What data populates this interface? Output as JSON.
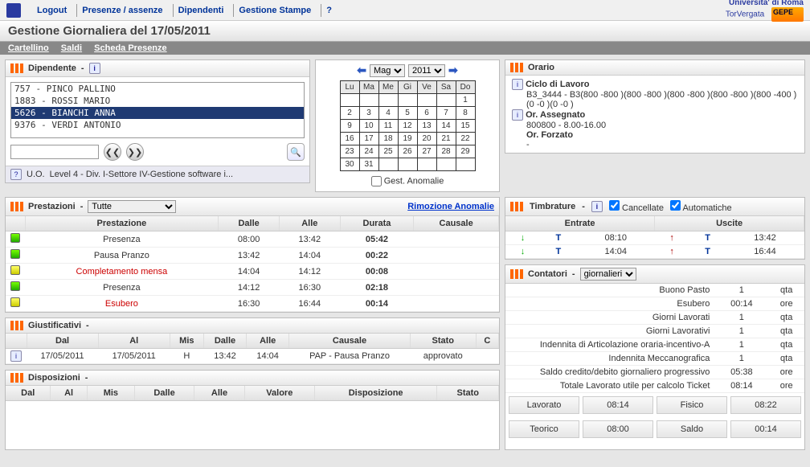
{
  "nav": {
    "logout": "Logout",
    "presenze": "Presenze / assenze",
    "dipendenti": "Dipendenti",
    "stampe": "Gestione Stampe",
    "help": "?"
  },
  "brand": {
    "line1": "Universita' di Roma",
    "line2": "TorVergata"
  },
  "title": "Gestione Giornaliera del 17/05/2011",
  "subtabs": {
    "cartellino": "Cartellino",
    "saldi": "Saldi",
    "scheda": "Scheda Presenze"
  },
  "dipendente": {
    "head": "Dipendente",
    "dash": "-",
    "list": [
      {
        "text": "757 - PINCO PALLINO"
      },
      {
        "text": "1883 - ROSSI MARIO"
      },
      {
        "text": "5626 - BIANCHI ANNA",
        "selected": true
      },
      {
        "text": "9376 - VERDI ANTONIO"
      }
    ],
    "uo_label": "U.O.",
    "uo_text": "Level 4 - Div. I-Settore IV-Gestione software i..."
  },
  "calendar": {
    "month": "Mag",
    "year": "2011",
    "dow": [
      "Lu",
      "Ma",
      "Me",
      "Gi",
      "Ve",
      "Sa",
      "Do"
    ],
    "weeks": [
      [
        "",
        "",
        "",
        "",
        "",
        "",
        "1"
      ],
      [
        "2",
        "3",
        "4",
        "5",
        "6",
        "7",
        "8"
      ],
      [
        "9",
        "10",
        "11",
        "12",
        "13",
        "14",
        "15"
      ],
      [
        "16",
        "17",
        "18",
        "19",
        "20",
        "21",
        "22"
      ],
      [
        "23",
        "24",
        "25",
        "26",
        "27",
        "28",
        "29"
      ],
      [
        "30",
        "31",
        "",
        "",
        "",
        "",
        ""
      ]
    ],
    "gest": "Gest. Anomalie"
  },
  "orario": {
    "head": "Orario",
    "ciclo_lbl": "Ciclo di Lavoro",
    "ciclo_val": "B3_3444 - B3(800 -800 )(800 -800 )(800 -800 )(800 -800 )(800 -400 )(0 -0 )(0 -0 )",
    "ass_lbl": "Or. Assegnato",
    "ass_val": "800800 - 8.00-16.00",
    "forz_lbl": "Or. Forzato",
    "forz_val": "-"
  },
  "prest": {
    "head": "Prestazioni",
    "dash": "-",
    "filter": "Tutte",
    "link": "Rimozione Anomalie",
    "cols": {
      "p": "Prestazione",
      "d": "Dalle",
      "a": "Alle",
      "du": "Durata",
      "c": "Causale"
    },
    "rows": [
      {
        "dot": "green",
        "p": "Presenza",
        "d": "08:00",
        "a": "13:42",
        "du": "05:42",
        "c": "",
        "red": false
      },
      {
        "dot": "green",
        "p": "Pausa Pranzo",
        "d": "13:42",
        "a": "14:04",
        "du": "00:22",
        "c": "",
        "red": false
      },
      {
        "dot": "yellow",
        "p": "Completamento mensa",
        "d": "14:04",
        "a": "14:12",
        "du": "00:08",
        "c": "",
        "red": true
      },
      {
        "dot": "green",
        "p": "Presenza",
        "d": "14:12",
        "a": "16:30",
        "du": "02:18",
        "c": "",
        "red": false
      },
      {
        "dot": "yellow",
        "p": "Esubero",
        "d": "16:30",
        "a": "16:44",
        "du": "00:14",
        "c": "",
        "red": true
      }
    ]
  },
  "timb": {
    "head": "Timbrature",
    "dash": "-",
    "cancellate": "Cancellate",
    "automatiche": "Automatiche",
    "col_e": "Entrate",
    "col_u": "Uscite",
    "rows": [
      {
        "e_time": "08:10",
        "u_time": "13:42",
        "badge": "T"
      },
      {
        "e_time": "14:04",
        "u_time": "16:44",
        "badge": "T"
      }
    ]
  },
  "giust": {
    "head": "Giustificativi",
    "dash": "-",
    "cols": {
      "dal": "Dal",
      "al": "Al",
      "mis": "Mis",
      "dalle": "Dalle",
      "alle": "Alle",
      "caus": "Causale",
      "stato": "Stato",
      "c": "C"
    },
    "row": {
      "dal": "17/05/2011",
      "al": "17/05/2011",
      "mis": "H",
      "dalle": "13:42",
      "alle": "14:04",
      "caus": "PAP - Pausa Pranzo",
      "stato": "approvato"
    }
  },
  "cont": {
    "head": "Contatori",
    "dash": "-",
    "select": "giornalieri",
    "rows": [
      {
        "k": "Buono Pasto",
        "v": "1",
        "u": "qta"
      },
      {
        "k": "Esubero",
        "v": "00:14",
        "u": "ore"
      },
      {
        "k": "Giorni Lavorati",
        "v": "1",
        "u": "qta"
      },
      {
        "k": "Giorni Lavorativi",
        "v": "1",
        "u": "qta"
      },
      {
        "k": "Indennita di Articolazione oraria-incentivo-A",
        "v": "1",
        "u": "qta"
      },
      {
        "k": "Indennita Meccanografica",
        "v": "1",
        "u": "qta"
      },
      {
        "k": "Saldo credito/debito giornaliero progressivo",
        "v": "05:38",
        "u": "ore"
      },
      {
        "k": "Totale Lavorato utile per calcolo Ticket",
        "v": "08:14",
        "u": "ore"
      }
    ]
  },
  "disp": {
    "head": "Disposizioni",
    "dash": "-",
    "cols": {
      "dal": "Dal",
      "al": "Al",
      "mis": "Mis",
      "dalle": "Dalle",
      "alle": "Alle",
      "val": "Valore",
      "disp": "Disposizione",
      "stato": "Stato"
    }
  },
  "summary": {
    "lav_l": "Lavorato",
    "lav_v": "08:14",
    "fis_l": "Fisico",
    "fis_v": "08:22",
    "teo_l": "Teorico",
    "teo_v": "08:00",
    "sal_l": "Saldo",
    "sal_v": "00:14"
  }
}
